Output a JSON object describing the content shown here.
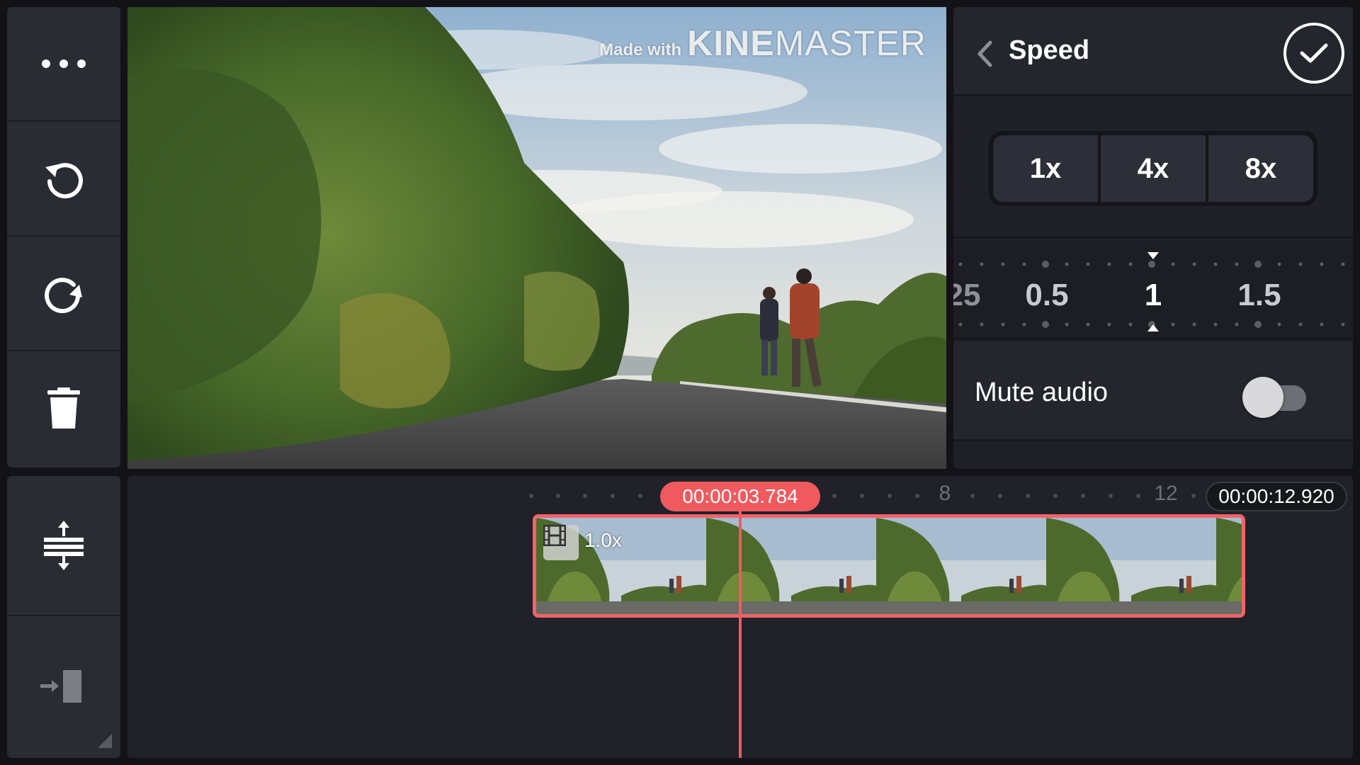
{
  "toolbar": {
    "items": [
      {
        "name": "more-options",
        "icon": "more-horizontal-icon"
      },
      {
        "name": "undo",
        "icon": "undo-icon"
      },
      {
        "name": "redo",
        "icon": "redo-icon"
      },
      {
        "name": "delete",
        "icon": "trash-icon"
      }
    ],
    "timeline_tools": [
      {
        "name": "expand-timeline",
        "icon": "expand-vertical-icon"
      },
      {
        "name": "jump-to-end",
        "icon": "jump-to-end-icon"
      }
    ]
  },
  "preview": {
    "watermark": {
      "prefix": "Made with",
      "brand_bold": "KINE",
      "brand_light": "MASTER"
    }
  },
  "panel": {
    "title": "Speed",
    "presets": [
      "1x",
      "4x",
      "8x"
    ],
    "ruler": {
      "labels": [
        "25",
        "0.5",
        "1",
        "1.5"
      ],
      "selected": "1"
    },
    "mute": {
      "label": "Mute audio",
      "enabled": false
    }
  },
  "timeline": {
    "marks": [
      "8",
      "12"
    ],
    "playhead_time": "00:00:03.784",
    "total_time": "00:00:12.920",
    "clip": {
      "speed_label": "1.0x"
    }
  },
  "colors": {
    "accent": "#f05a5f",
    "panel_bg": "#202128",
    "toolbar_bg": "#2a2c33"
  }
}
